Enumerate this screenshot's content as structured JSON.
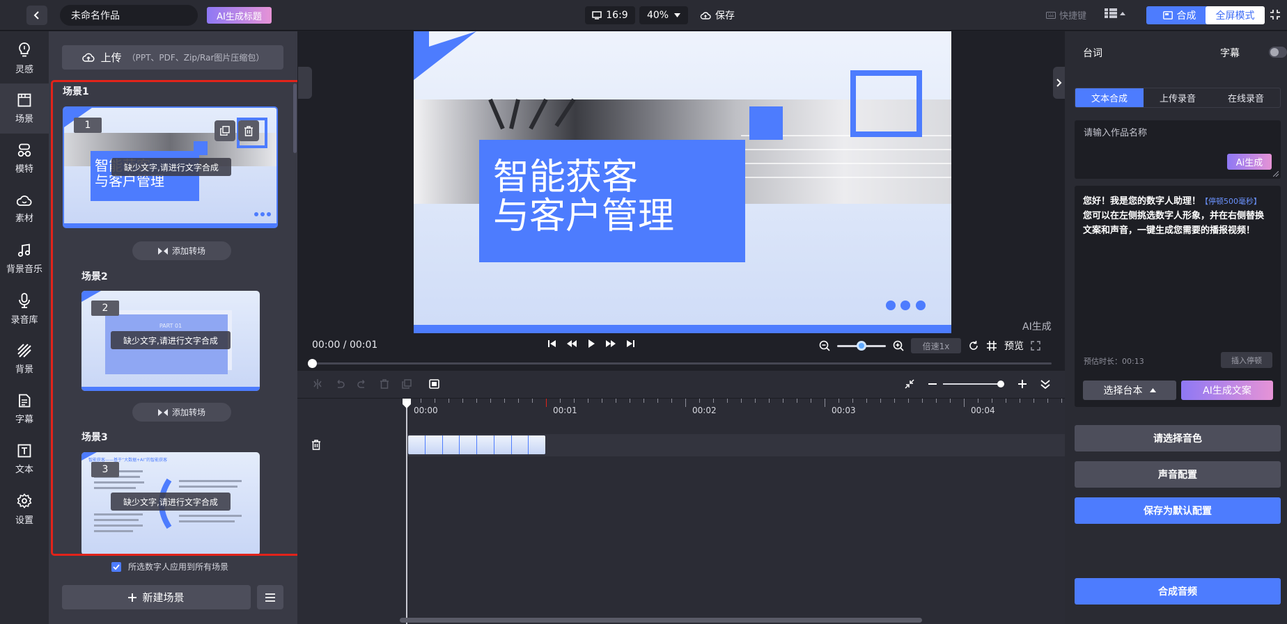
{
  "header": {
    "title_value": "未命名作品",
    "ai_title_label": "AI生成标题",
    "aspect_ratio": "16:9",
    "zoom": "40%",
    "save_label": "保存",
    "shortcut_label": "快捷键",
    "compose_label": "合成",
    "fullscreen_label": "全屏模式"
  },
  "nav": {
    "items": [
      {
        "label": "灵感",
        "icon": "lightbulb-icon"
      },
      {
        "label": "场景",
        "icon": "scene-icon"
      },
      {
        "label": "模特",
        "icon": "avatar-icon"
      },
      {
        "label": "素材",
        "icon": "cloud-icon"
      },
      {
        "label": "背景音乐",
        "icon": "music-icon"
      },
      {
        "label": "录音库",
        "icon": "microphone-icon"
      },
      {
        "label": "背景",
        "icon": "background-icon"
      },
      {
        "label": "字幕",
        "icon": "subtitle-icon"
      },
      {
        "label": "文本",
        "icon": "text-icon"
      },
      {
        "label": "设置",
        "icon": "gear-icon"
      }
    ],
    "active_index": 1
  },
  "scenes": {
    "upload_label": "上传",
    "upload_hint": "（PPT、PDF、Zip/Rar图片压缩包）",
    "warning_text": "缺少文字,请进行文字合成",
    "add_transition_label": "添加转场",
    "list": [
      {
        "label": "场景1",
        "number": "1",
        "thumb_title_line1": "智能获客",
        "thumb_title_line2": "与客户管理"
      },
      {
        "label": "场景2",
        "number": "2",
        "thumb_title_line1": "PART 01"
      },
      {
        "label": "场景3",
        "number": "3",
        "thumb_title_line1": "智能获客——基于“大数据+AI”的智能获客"
      }
    ],
    "apply_all_label": "所选数字人应用到所有场景",
    "new_scene_label": "新建场景"
  },
  "canvas": {
    "title_line1": "智能获客",
    "title_line2": "与客户管理",
    "ai_label": "AI生成"
  },
  "player": {
    "timecode": "00:00 / 00:01",
    "speed_label": "倍速1x",
    "preview_label": "预览",
    "zoom_slider": 0.5
  },
  "timeline": {
    "ticks": [
      "00:00",
      "00:01",
      "00:02",
      "00:03",
      "00:04"
    ],
    "zoom_slider": 1.0
  },
  "right": {
    "lines_label": "台词",
    "subtitle_label": "字幕",
    "subtitle_on": false,
    "tabs": [
      "文本合成",
      "上传录音",
      "在线录音"
    ],
    "active_tab": 0,
    "name_placeholder": "请输入作品名称",
    "ai_gen_label": "Ai生成",
    "script_line1": "您好！我是您的数字人助理！",
    "pause_tag": "【停顿500毫秒】",
    "script_line2": "您可以在左侧挑选数字人形象，并在右侧替换文案和声音，一键生成您需要的播报视频！",
    "est_time": "预估时长：00:13",
    "insert_pause_label": "插入停顿",
    "choose_script_label": "选择台本",
    "ai_copy_label": "AI生成文案",
    "choose_voice_label": "请选择音色",
    "voice_config_label": "声音配置",
    "save_default_label": "保存为默认配置",
    "compose_audio_label": "合成音频"
  },
  "colors": {
    "accent": "#4d7cfe",
    "warning_outline": "#e2231a",
    "ai_gradient_start": "#8e78f4",
    "ai_gradient_end": "#e693d6"
  }
}
